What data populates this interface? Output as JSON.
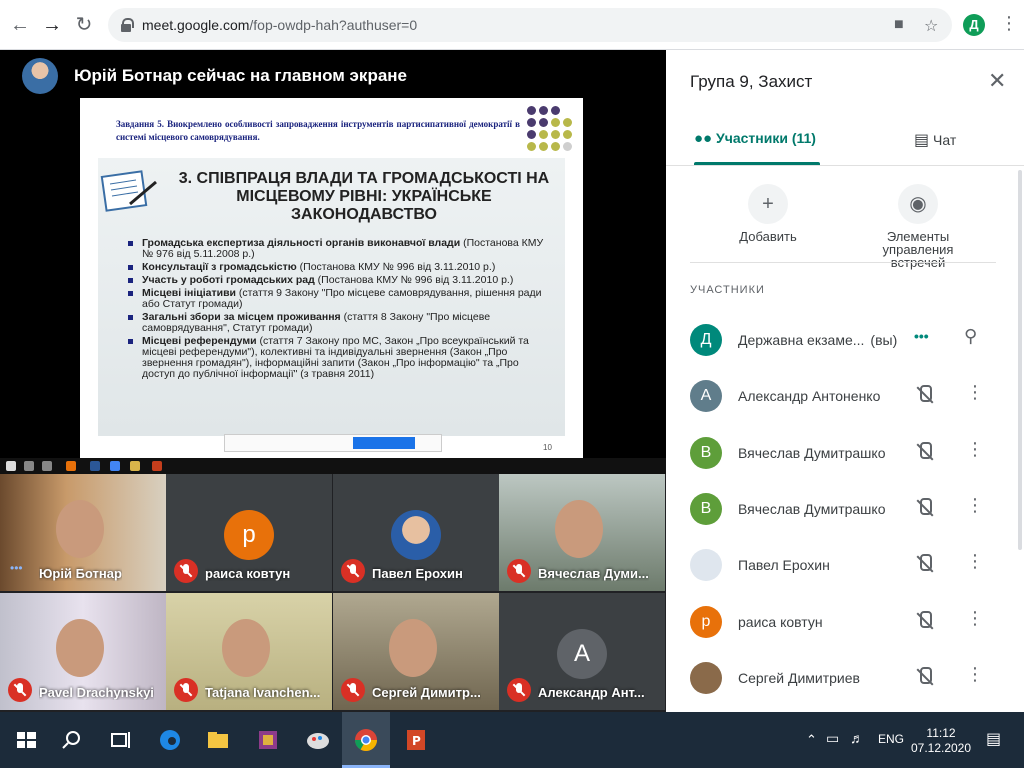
{
  "browser": {
    "url_host": "meet.google.com",
    "url_path": "/fop-owdp-hah?authuser=0",
    "profile_initial": "Д"
  },
  "presenter": {
    "text": "Юрій Ботнар сейчас на главном экране"
  },
  "slide": {
    "task": "Завдання 5. Виокремлено особливості запровадження інструментів партисипативної демократії в системі місцевого самоврядування.",
    "heading": "3. СПІВПРАЦЯ ВЛАДИ ТА ГРОМАДСЬКОСТІ НА МІСЦЕВОМУ РІВНІ: УКРАЇНСЬКЕ ЗАКОНОДАВСТВО",
    "bullets": [
      {
        "bold": "Громадська експертиза діяльності органів виконавчої влади",
        "rest": " (Постанова КМУ № 976 від 5.11.2008 р.)"
      },
      {
        "bold": "Консультації з громадськістю",
        "rest": " (Постанова КМУ № 996 від 3.11.2010 р.)"
      },
      {
        "bold": "Участь у роботі громадських рад",
        "rest": " (Постанова КМУ № 996 від 3.11.2010 р.)"
      },
      {
        "bold": "Місцеві ініціативи",
        "rest": " (стаття 9 Закону \"Про місцеве самоврядування, рішення ради або Статут громади)"
      },
      {
        "bold": "Загальні збори за місцем проживання",
        "rest": " (стаття 8 Закону \"Про місцеве самоврядування\", Статут громади)"
      },
      {
        "bold": "Місцеві референдуми",
        "rest": " (стаття 7 Закону про МС, Закон „Про всеукраїнський та місцеві референдуми\"), колективні та індивідуальні звернення (Закон „Про звернення громадян\"), інформаційні запити (Закон „Про інформацію\" та „Про доступ до публічної інформації\" (з травня 2011)"
      }
    ],
    "page_number": "10"
  },
  "tiles": [
    {
      "name": "Юрій Ботнар",
      "muted": false
    },
    {
      "name": "раиса ковтун",
      "muted": true,
      "initial": "р",
      "color": "#e8710a"
    },
    {
      "name": "Павел Ерохин",
      "muted": true
    },
    {
      "name": "Вячеслав Думи...",
      "muted": true
    },
    {
      "name": "Pavel Drachynskyi",
      "muted": true
    },
    {
      "name": "Tatjana Ivanchen...",
      "muted": true
    },
    {
      "name": "Сергей Димитр...",
      "muted": true
    },
    {
      "name": "Александр Ант...",
      "muted": true,
      "initial": "А",
      "color": "#5f6368"
    }
  ],
  "panel": {
    "title": "Група 9, Захист",
    "tab_people": "Участники (11)",
    "tab_chat": "Чат",
    "action_add": "Добавить",
    "action_controls": "Элементы управления встречей",
    "section": "УЧАСТНИКИ",
    "participants": [
      {
        "name": "Державна екзаме...",
        "you": "(вы)",
        "initial": "Д",
        "color": "#00897b"
      },
      {
        "name": "Александр Антоненко",
        "initial": "А",
        "color": "#607d8b"
      },
      {
        "name": "Вячеслав Думитрашко",
        "initial": "В",
        "color": "#5e9e3a"
      },
      {
        "name": "Вячеслав Думитрашко",
        "initial": "В",
        "color": "#5e9e3a"
      },
      {
        "name": "Павел Ерохин",
        "initial": "",
        "color": "#dfe6ee"
      },
      {
        "name": "раиса ковтун",
        "initial": "р",
        "color": "#e8710a"
      },
      {
        "name": "Сергей Димитриев",
        "initial": "",
        "color": "#8a6a4a"
      }
    ]
  },
  "taskbar": {
    "lang": "ENG",
    "time": "11:12",
    "date": "07.12.2020"
  }
}
